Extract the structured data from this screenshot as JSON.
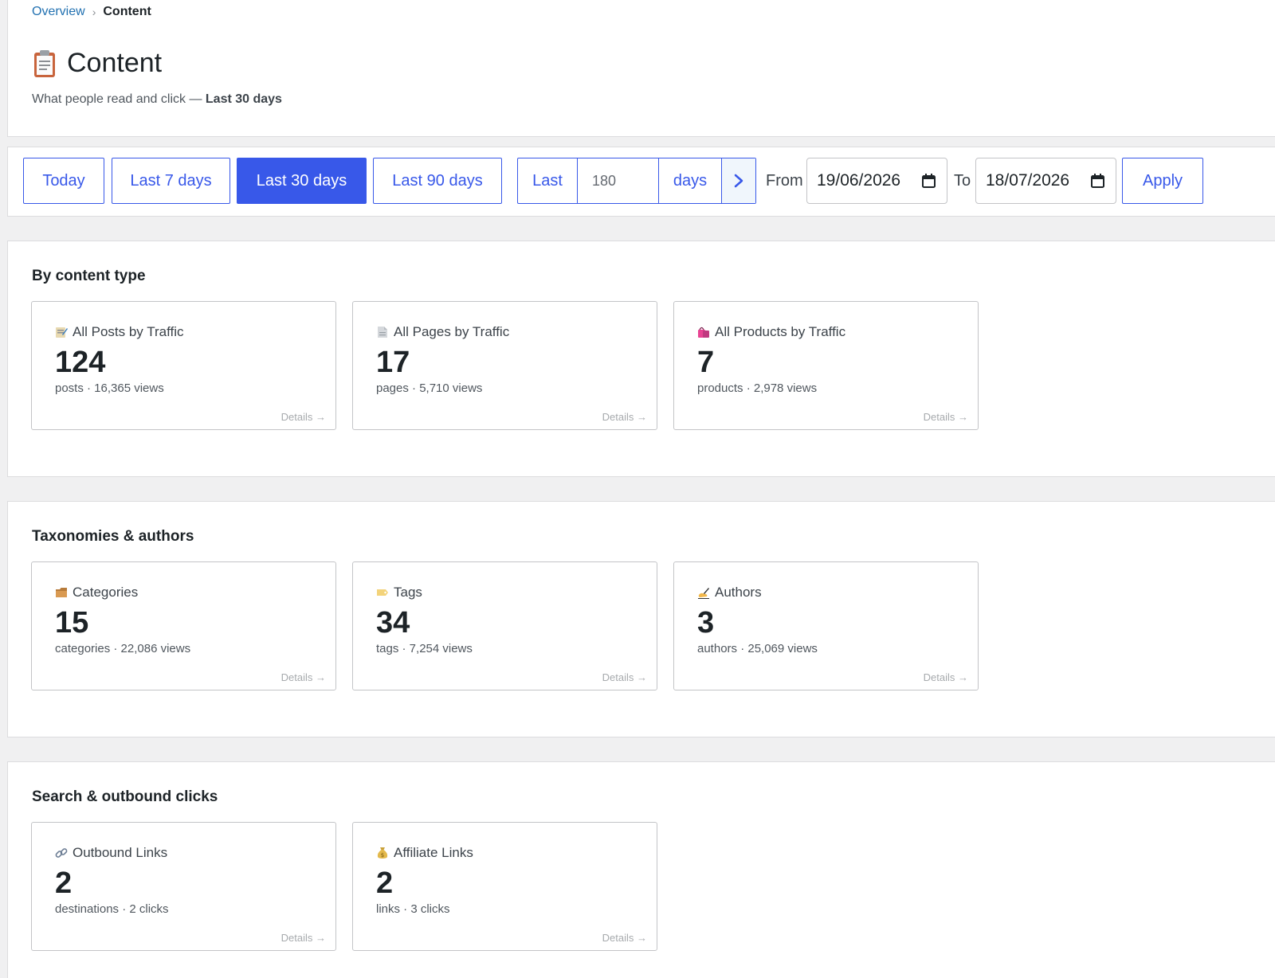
{
  "breadcrumb": {
    "parent": "Overview",
    "separator": "›",
    "current": "Content"
  },
  "header": {
    "title": "Content",
    "title_icon": "clipboard-icon",
    "subtitle_prefix": "What people read and click — ",
    "subtitle_range": "Last 30 days"
  },
  "toolbar": {
    "presets": [
      {
        "label": "Today",
        "active": false
      },
      {
        "label": "Last 7 days",
        "active": false
      },
      {
        "label": "Last 30 days",
        "active": true
      },
      {
        "label": "Last 90 days",
        "active": false
      }
    ],
    "custom": {
      "prefix": "Last",
      "value": "180",
      "suffix": "days",
      "go_icon": "chevron-right-icon"
    },
    "from_label": "From",
    "from_value": "19/06/2026",
    "to_label": "To",
    "to_value": "18/07/2026",
    "apply_label": "Apply",
    "accent": "#3858e9"
  },
  "sections": [
    {
      "title": "By content type",
      "cards": [
        {
          "icon": "memo-icon",
          "label": "All Posts by Traffic",
          "value": "124",
          "meta": "posts · 16,365 views",
          "details": "Details →"
        },
        {
          "icon": "page-icon",
          "label": "All Pages by Traffic",
          "value": "17",
          "meta": "pages · 5,710 views",
          "details": "Details →"
        },
        {
          "icon": "shopping-bags-icon",
          "label": "All Products by Traffic",
          "value": "7",
          "meta": "products · 2,978 views",
          "details": "Details →"
        }
      ]
    },
    {
      "title": "Taxonomies & authors",
      "cards": [
        {
          "icon": "folder-icon",
          "label": "Categories",
          "value": "15",
          "meta": "categories · 22,086 views",
          "details": "Details →"
        },
        {
          "icon": "tag-icon",
          "label": "Tags",
          "value": "34",
          "meta": "tags · 7,254 views",
          "details": "Details →"
        },
        {
          "icon": "writing-hand-icon",
          "label": "Authors",
          "value": "3",
          "meta": "authors · 25,069 views",
          "details": "Details →"
        }
      ]
    },
    {
      "title": "Search & outbound clicks",
      "cards": [
        {
          "icon": "link-icon",
          "label": "Outbound Links",
          "value": "2",
          "meta": "destinations · 2 clicks",
          "details": "Details →"
        },
        {
          "icon": "money-bag-icon",
          "label": "Affiliate Links",
          "value": "2",
          "meta": "links · 3 clicks",
          "details": "Details →"
        }
      ]
    }
  ]
}
